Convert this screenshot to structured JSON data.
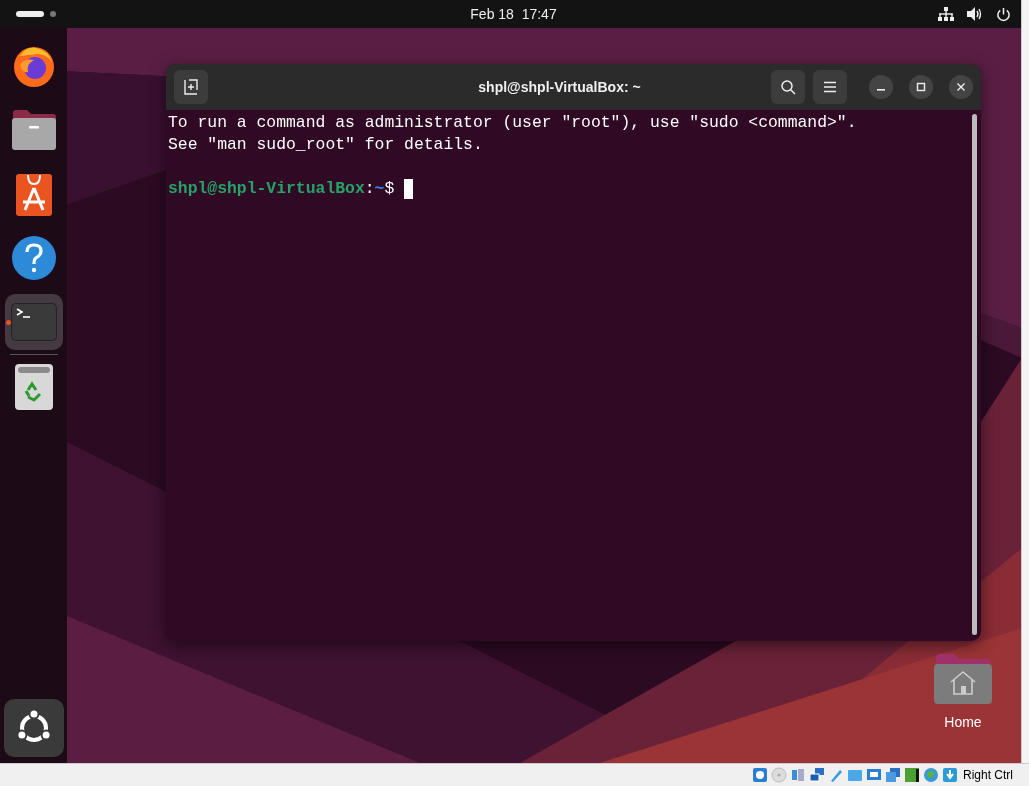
{
  "top_bar": {
    "workspaces": [
      {
        "selected": true
      },
      {
        "selected": false
      }
    ],
    "clock": "Feb 18  17:47"
  },
  "dock": {
    "apps": [
      {
        "kind": "browser",
        "running": false
      },
      {
        "kind": "files",
        "running": false
      },
      {
        "kind": "software",
        "running": false
      },
      {
        "kind": "help",
        "running": false
      },
      {
        "kind": "terminal",
        "running": true
      }
    ],
    "pinned_after_separator": [
      {
        "kind": "trash",
        "running": false
      }
    ]
  },
  "terminal": {
    "title": "shpl@shpl-VirtualBox: ~",
    "lines": [
      "To run a command as administrator (user \"root\"), use \"sudo <command>\".",
      "See \"man sudo_root\" for details."
    ],
    "prompt": {
      "user_host": "shpl@shpl-VirtualBox",
      "separator": ":",
      "path": "~",
      "symbol": "$"
    }
  },
  "desktop_icons": [
    {
      "label": "Home"
    }
  ],
  "status_bar": {
    "host_key": "Right Ctrl"
  }
}
